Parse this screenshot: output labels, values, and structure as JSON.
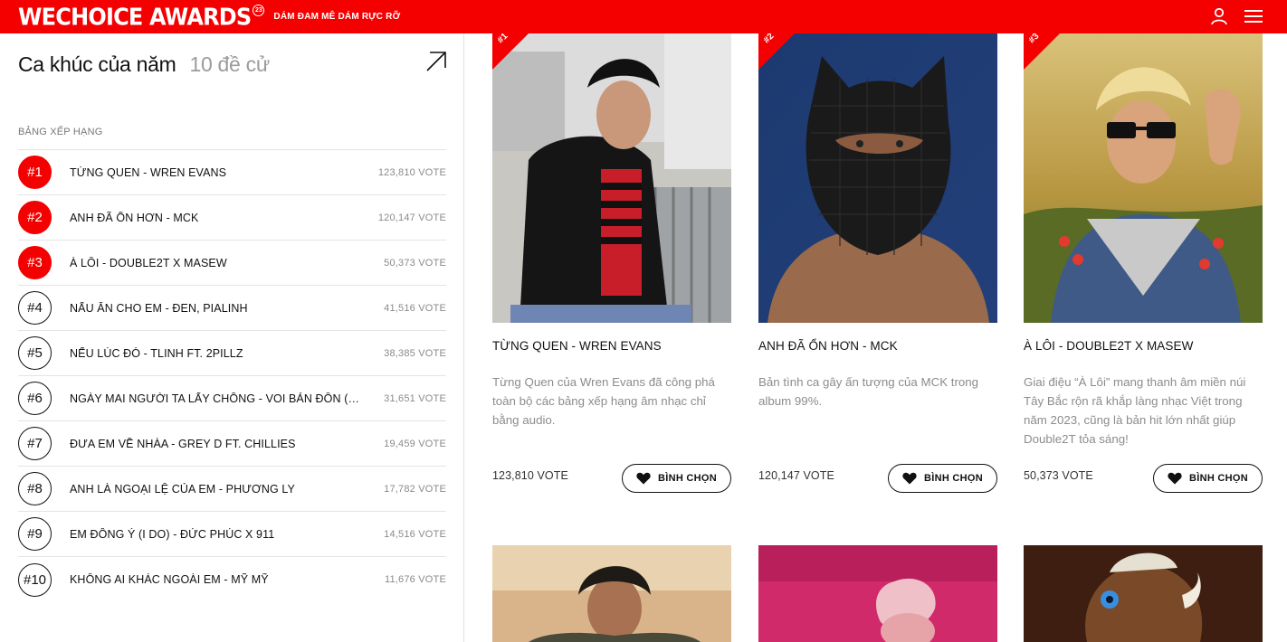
{
  "header": {
    "logo": "WECHOICE AWARDS",
    "logo_badge": "23",
    "tagline": "DÁM ĐAM MÊ DÁM RỰC RỠ"
  },
  "category": {
    "title": "Ca khúc của năm",
    "count": "10 đề cử"
  },
  "ranking": {
    "label": "BẢNG XẾP HẠNG",
    "items": [
      {
        "rank": "#1",
        "name": "TỪNG QUEN - WREN EVANS",
        "votes": "123,810 VOTE"
      },
      {
        "rank": "#2",
        "name": "ANH ĐÃ ỔN HƠN - MCK",
        "votes": "120,147 VOTE"
      },
      {
        "rank": "#3",
        "name": "À LÔI - DOUBLE2T X MASEW",
        "votes": "50,373 VOTE"
      },
      {
        "rank": "#4",
        "name": "NẤU ĂN CHO EM - ĐEN, PIALINH",
        "votes": "41,516 VOTE"
      },
      {
        "rank": "#5",
        "name": "NẾU LÚC ĐÓ - TLINH FT. 2PILLZ",
        "votes": "38,385 VOTE"
      },
      {
        "rank": "#6",
        "name": "NGÀY MAI NGƯỜI TA LẤY CHỒNG - VOI BẢN ĐÔN (AN...",
        "votes": "31,651 VOTE"
      },
      {
        "rank": "#7",
        "name": "ĐƯA EM VỀ NHÀA - GREY D FT. CHILLIES",
        "votes": "19,459 VOTE"
      },
      {
        "rank": "#8",
        "name": "ANH LÀ NGOẠI LỆ CỦA EM - PHƯƠNG LY",
        "votes": "17,782 VOTE"
      },
      {
        "rank": "#9",
        "name": "EM ĐỒNG Ý (I DO) - ĐỨC PHÚC X 911",
        "votes": "14,516 VOTE"
      },
      {
        "rank": "#10",
        "name": "KHÔNG AI KHÁC NGOÀI EM - MỸ MỸ",
        "votes": "11,676 VOTE"
      }
    ]
  },
  "cards": [
    {
      "rank": "#1",
      "title": "TỪNG QUEN - WREN EVANS",
      "desc": "Từng Quen của Wren Evans đã công phá toàn bộ các bảng xếp hạng âm nhạc chỉ bằng audio.",
      "votes": "123,810 VOTE",
      "button": "BÌNH CHỌN"
    },
    {
      "rank": "#2",
      "title": "ANH ĐÃ ỔN HƠN - MCK",
      "desc": "Bản tình ca gây ấn tượng của MCK trong album 99%.",
      "votes": "120,147 VOTE",
      "button": "BÌNH CHỌN"
    },
    {
      "rank": "#3",
      "title": "À LÔI - DOUBLE2T X MASEW",
      "desc": "Giai điệu “À Lôi” mang thanh âm miền núi Tây Bắc rộn rã khắp làng nhạc Việt trong năm 2023, cũng là bản hit lớn nhất giúp Double2T tỏa sáng!",
      "votes": "50,373 VOTE",
      "button": "BÌNH CHỌN"
    }
  ]
}
